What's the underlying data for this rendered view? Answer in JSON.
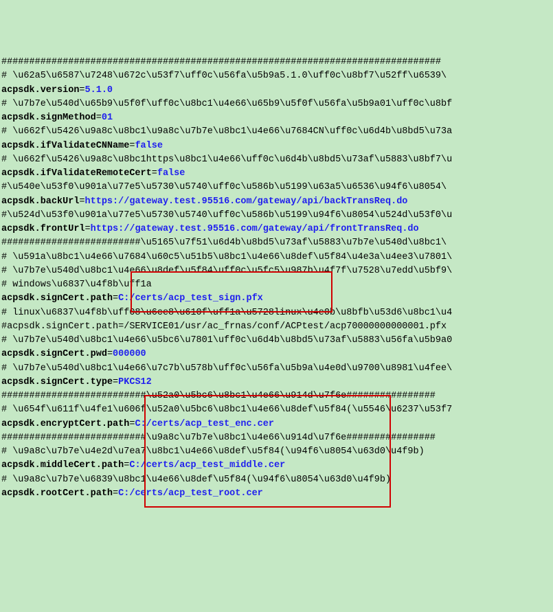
{
  "lines": [
    {
      "type": "hash",
      "text": "###############################################################################"
    },
    {
      "type": "comment",
      "text": "# \\u62a5\\u6587\\u7248\\u672c\\u53f7\\uff0c\\u56fa\\u5b9a5.1.0\\uff0c\\u8bf7\\u52ff\\u6539\\"
    },
    {
      "type": "kv",
      "key": "acpsdk.version",
      "value": "5.1.0",
      "blue": true
    },
    {
      "type": "comment",
      "text": "# \\u7b7e\\u540d\\u65b9\\u5f0f\\uff0c\\u8bc1\\u4e66\\u65b9\\u5f0f\\u56fa\\u5b9a01\\uff0c\\u8bf"
    },
    {
      "type": "kv",
      "key": "acpsdk.signMethod",
      "value": "01",
      "blue": true
    },
    {
      "type": "comment",
      "text": "# \\u662f\\u5426\\u9a8c\\u8bc1\\u9a8c\\u7b7e\\u8bc1\\u4e66\\u7684CN\\uff0c\\u6d4b\\u8bd5\\u73a"
    },
    {
      "type": "kv",
      "key": "acpsdk.ifValidateCNName",
      "value": "false",
      "blue": true
    },
    {
      "type": "comment",
      "text": "# \\u662f\\u5426\\u9a8c\\u8bc1https\\u8bc1\\u4e66\\uff0c\\u6d4b\\u8bd5\\u73af\\u5883\\u8bf7\\u"
    },
    {
      "type": "kv",
      "key": "acpsdk.ifValidateRemoteCert",
      "value": "false",
      "blue": true
    },
    {
      "type": "comment",
      "text": "#\\u540e\\u53f0\\u901a\\u77e5\\u5730\\u5740\\uff0c\\u586b\\u5199\\u63a5\\u6536\\u94f6\\u8054\\"
    },
    {
      "type": "kv",
      "key": "acpsdk.backUrl",
      "value": "https://gateway.test.95516.com/gateway/api/backTransReq.do",
      "blue": true
    },
    {
      "type": "comment",
      "text": "#\\u524d\\u53f0\\u901a\\u77e5\\u5730\\u5740\\uff0c\\u586b\\u5199\\u94f6\\u8054\\u524d\\u53f0\\u"
    },
    {
      "type": "kv",
      "key": "acpsdk.frontUrl",
      "value": "https://gateway.test.95516.com/gateway/api/frontTransReq.do",
      "blue": true
    },
    {
      "type": "comment",
      "text": "#########################\\u5165\\u7f51\\u6d4b\\u8bd5\\u73af\\u5883\\u7b7e\\u540d\\u8bc1\\"
    },
    {
      "type": "comment",
      "text": "# \\u591a\\u8bc1\\u4e66\\u7684\\u60c5\\u51b5\\u8bc1\\u4e66\\u8def\\u5f84\\u4e3a\\u4ee3\\u7801\\"
    },
    {
      "type": "comment",
      "text": "# \\u7b7e\\u540d\\u8bc1\\u4e66\\u8def\\u5f84\\uff0c\\u5fc5\\u987b\\u4f7f\\u7528\\u7edd\\u5bf9\\"
    },
    {
      "type": "comment",
      "text": "# windows\\u6837\\u4f8b\\uff1a"
    },
    {
      "type": "kv",
      "key": "acpsdk.signCert.path",
      "value": "C:/certs/acp_test_sign.pfx",
      "blue": true
    },
    {
      "type": "comment",
      "text": "# linux\\u6837\\u4f8b\\uff08\\u6ce8\\u610f\\uff1a\\u5728linux\\u4e0b\\u8bfb\\u53d6\\u8bc1\\u4"
    },
    {
      "type": "comment",
      "text": "#acpsdk.signCert.path=/SERVICE01/usr/ac_frnas/conf/ACPtest/acp70000000000001.pfx"
    },
    {
      "type": "comment",
      "text": "# \\u7b7e\\u540d\\u8bc1\\u4e66\\u5bc6\\u7801\\uff0c\\u6d4b\\u8bd5\\u73af\\u5883\\u56fa\\u5b9a0"
    },
    {
      "type": "kv",
      "key": "acpsdk.signCert.pwd",
      "value": "000000",
      "blue": true
    },
    {
      "type": "comment",
      "text": "# \\u7b7e\\u540d\\u8bc1\\u4e66\\u7c7b\\u578b\\uff0c\\u56fa\\u5b9a\\u4e0d\\u9700\\u8981\\u4fee\\"
    },
    {
      "type": "kv",
      "key": "acpsdk.signCert.type",
      "value": "PKCS12",
      "blue": true
    },
    {
      "type": "hash",
      "text": "##########################\\u52a0\\u5bc6\\u8bc1\\u4e66\\u914d\\u7f6e################"
    },
    {
      "type": "comment",
      "text": "# \\u654f\\u611f\\u4fe1\\u606f\\u52a0\\u5bc6\\u8bc1\\u4e66\\u8def\\u5f84(\\u5546\\u6237\\u53f7"
    },
    {
      "type": "kv",
      "key": "acpsdk.encryptCert.path",
      "value": "C:/certs/acp_test_enc.cer",
      "blue": true
    },
    {
      "type": "hash",
      "text": "##########################\\u9a8c\\u7b7e\\u8bc1\\u4e66\\u914d\\u7f6e################"
    },
    {
      "type": "comment",
      "text": "# \\u9a8c\\u7b7e\\u4e2d\\u7ea7\\u8bc1\\u4e66\\u8def\\u5f84(\\u94f6\\u8054\\u63d0\\u4f9b)"
    },
    {
      "type": "kv",
      "key": "acpsdk.middleCert.path",
      "value": "C:/certs/acp_test_middle.cer",
      "blue": true
    },
    {
      "type": "comment",
      "text": "# \\u9a8c\\u7b7e\\u6839\\u8bc1\\u4e66\\u8def\\u5f84(\\u94f6\\u8054\\u63d0\\u4f9b)"
    },
    {
      "type": "kv",
      "key": "acpsdk.rootCert.path",
      "value": "C:/certs/acp_test_root.cer",
      "blue": true
    }
  ],
  "highlight_boxes": [
    {
      "id": "box1"
    },
    {
      "id": "box2"
    }
  ]
}
